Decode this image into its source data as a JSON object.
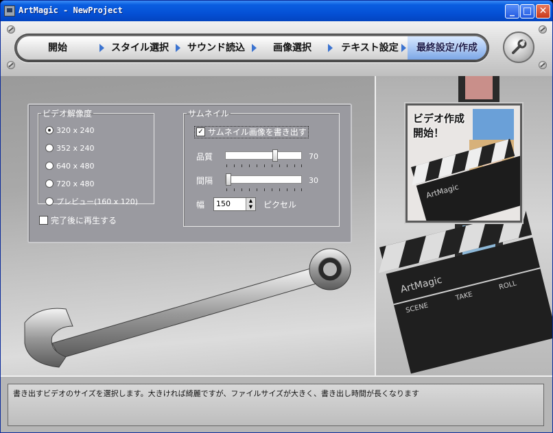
{
  "window": {
    "title": "ArtMagic - NewProject"
  },
  "titlebar_buttons": {
    "minimize": "_",
    "maximize": "□",
    "close": "✕"
  },
  "steps": [
    {
      "label": "開始",
      "active": false
    },
    {
      "label": "スタイル選択",
      "active": false
    },
    {
      "label": "サウンド読込",
      "active": false
    },
    {
      "label": "画像選択",
      "active": false
    },
    {
      "label": "テキスト設定",
      "active": false
    },
    {
      "label": "最終設定/作成",
      "active": true
    }
  ],
  "resolution": {
    "legend": "ビデオ解像度",
    "options": [
      "320 x 240",
      "352 x 240",
      "640 x 480",
      "720 x 480",
      "プレビュー(160 x 120)"
    ],
    "selected": "320 x 240",
    "play_after_checkbox": "完了後に再生する",
    "play_after_checked": false
  },
  "thumbnail": {
    "legend": "サムネイル",
    "write_checkbox": "サムネイル画像を書き出す",
    "write_checked": true,
    "quality_label": "品質",
    "quality_value": "70",
    "interval_label": "間隔",
    "interval_value": "30",
    "width_label": "幅",
    "width_value": "150",
    "width_unit": "ピクセル"
  },
  "banner": {
    "title": "ビデオ作成 開始！",
    "clapboard_text": "ArtMagic",
    "clapboard_fields": [
      "SCENE",
      "TAKE",
      "ROLL"
    ]
  },
  "status_message": "書き出すビデオのサイズを選択します。大きければ綺麗ですが、ファイルサイズが大きく、書き出し時間が長くなります"
}
